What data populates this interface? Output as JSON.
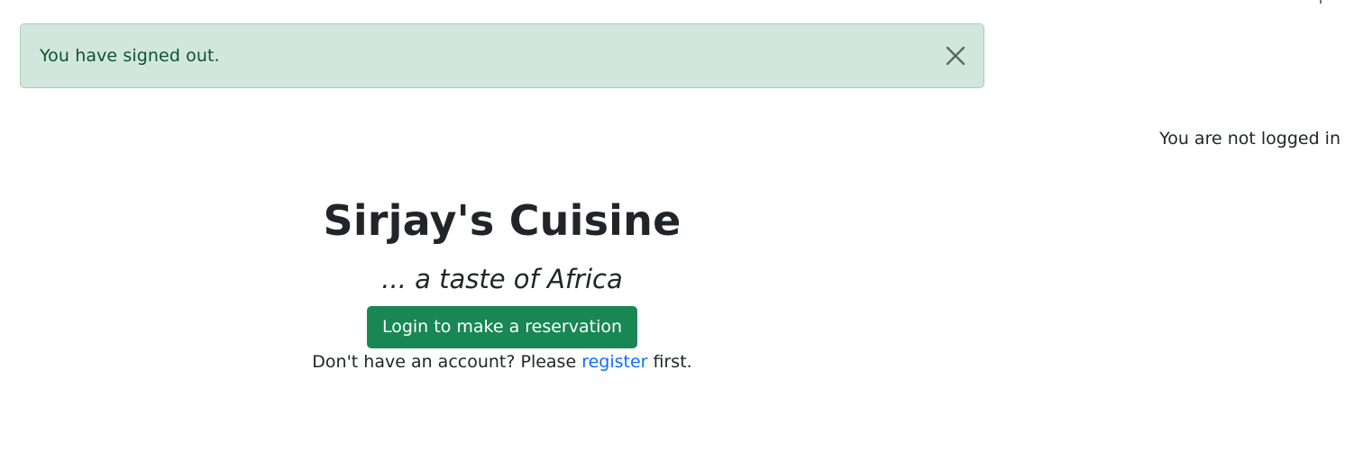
{
  "alert": {
    "message": "You have signed out.",
    "close_icon": "close-icon",
    "background": "#d1e7dd",
    "text_color": "#0f5132"
  },
  "status": {
    "login_text": "You are not logged in"
  },
  "hero": {
    "title": "Sirjay's Cuisine",
    "tagline": "... a taste of Africa",
    "cta_label": "Login to make a reservation",
    "register_prefix": "Don't have an account? Please ",
    "register_link": "register",
    "register_suffix": " first."
  },
  "colors": {
    "primary_green": "#198754",
    "link_blue": "#0d6efd",
    "text": "#212529"
  }
}
